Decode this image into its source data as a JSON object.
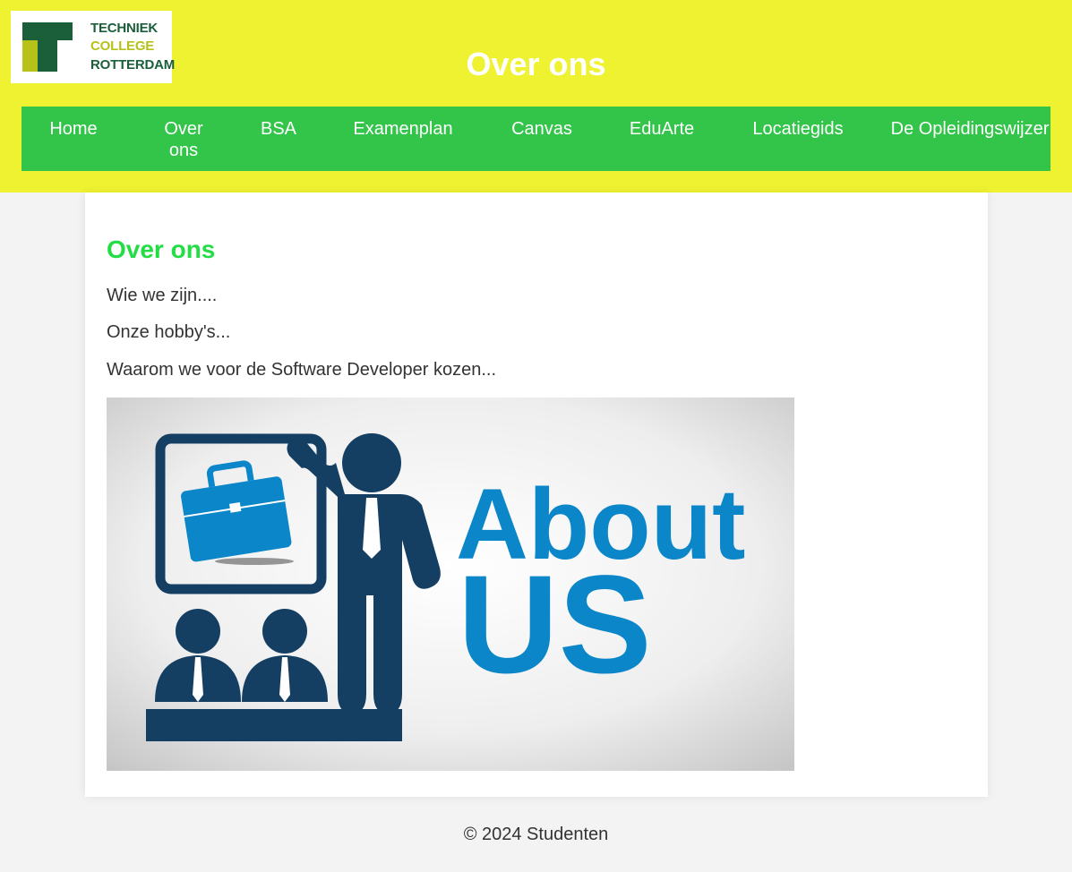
{
  "header": {
    "logo": {
      "line1": "TECHNIEK",
      "line2": "COLLEGE",
      "line3": "ROTTERDAM"
    },
    "title": "Over ons"
  },
  "nav": {
    "items": [
      {
        "label": "Home"
      },
      {
        "label": "Over ons"
      },
      {
        "label": "BSA"
      },
      {
        "label": "Examenplan"
      },
      {
        "label": "Canvas"
      },
      {
        "label": "EduArte"
      },
      {
        "label": "Locatiegids"
      },
      {
        "label": "De Opleidingswijzer"
      }
    ]
  },
  "main": {
    "heading": "Over ons",
    "paragraphs": [
      "Wie we zijn....",
      "Onze hobby's...",
      "Waarom we voor de Software Developer kozen..."
    ],
    "image": {
      "word1": "About",
      "word2": "US"
    }
  },
  "footer": {
    "text": "© 2024 Studenten"
  },
  "colors": {
    "header_bg": "#eff230",
    "nav_bg": "#33c44a",
    "heading": "#22dd44",
    "logo_dark": "#1a5e3a",
    "logo_lime": "#b6c21a",
    "icon_navy": "#143f63",
    "about_blue": "#0a86c9"
  }
}
